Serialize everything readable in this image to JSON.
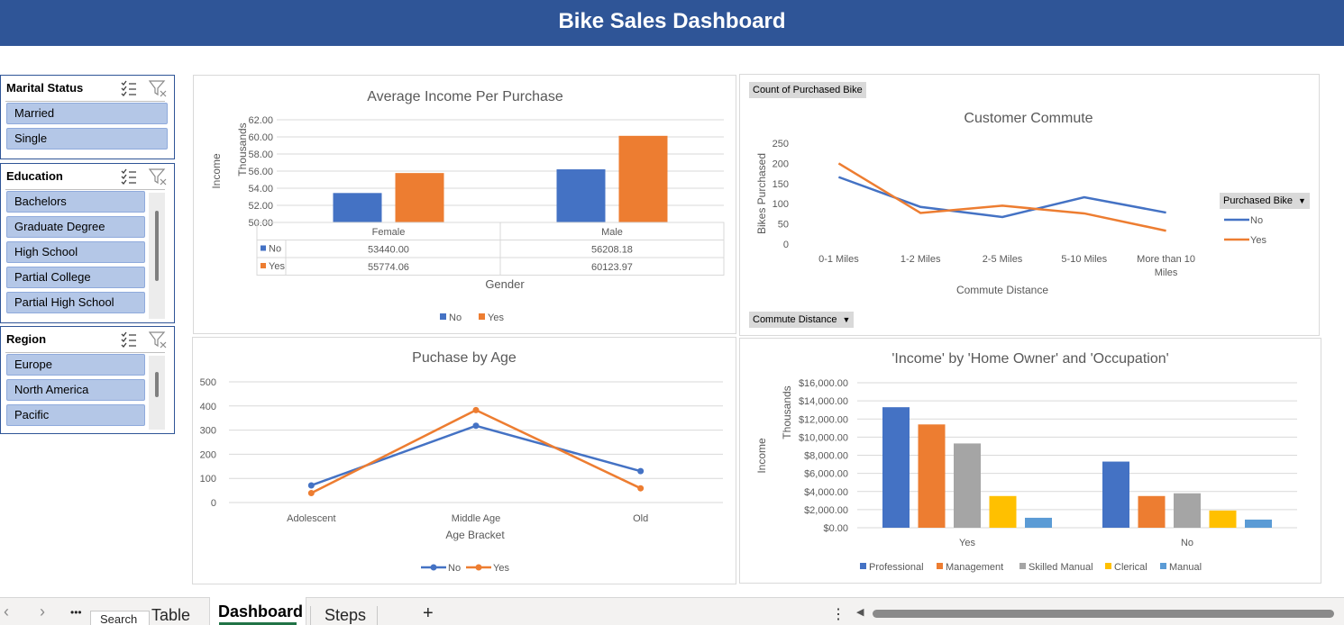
{
  "banner": {
    "title": "Bike Sales Dashboard",
    "bg": "#2f5597"
  },
  "colors": {
    "no": "#4472c4",
    "yes": "#ed7d31",
    "skilled": "#a5a5a5",
    "clerical": "#ffc000",
    "manual": "#5b9bd5"
  },
  "slicers": [
    {
      "title": "Marital Status",
      "items": [
        "Married",
        "Single"
      ],
      "scroll": false
    },
    {
      "title": "Education",
      "items": [
        "Bachelors",
        "Graduate Degree",
        "High School",
        "Partial College",
        "Partial High School"
      ],
      "scroll": true
    },
    {
      "title": "Region",
      "items": [
        "Europe",
        "North America",
        "Pacific"
      ],
      "scroll": true
    }
  ],
  "chart_data": [
    {
      "type": "bar",
      "title": "Average Income Per Purchase",
      "xlabel": "Gender",
      "ylabel": "Income",
      "yunit": "Thousands",
      "categories": [
        "Female",
        "Male"
      ],
      "series": [
        {
          "name": "No",
          "values": [
            53440.0,
            56208.18
          ],
          "labels": [
            "53440.00",
            "56208.18"
          ]
        },
        {
          "name": "Yes",
          "values": [
            55774.06,
            60123.97
          ],
          "labels": [
            "55774.06",
            "60123.97"
          ]
        }
      ],
      "yticks": [
        "62.00",
        "60.00",
        "58.00",
        "56.00",
        "54.00",
        "52.00",
        "50.00"
      ],
      "ylim": [
        50,
        62
      ],
      "legend": [
        "No",
        "Yes"
      ],
      "legend_position": "bottom",
      "data_table": true,
      "grid": true
    },
    {
      "type": "line",
      "title": "Customer Commute",
      "xlabel": "Commute Distance",
      "ylabel": "Bikes Purchased",
      "categories": [
        "0-1 Miles",
        "1-2 Miles",
        "2-5 Miles",
        "5-10 Miles",
        "More than 10 Miles"
      ],
      "series": [
        {
          "name": "No",
          "values": [
            166,
            92,
            67,
            116,
            78
          ]
        },
        {
          "name": "Yes",
          "values": [
            200,
            77,
            95,
            76,
            33
          ]
        }
      ],
      "yticks": [
        "250",
        "200",
        "150",
        "100",
        "50",
        "0"
      ],
      "ylim": [
        0,
        250
      ],
      "pivot_value_button": "Count of Purchased Bike",
      "pivot_axis_button": "Commute Distance",
      "legend_title": "Purchased Bike",
      "legend": [
        "No",
        "Yes"
      ],
      "legend_position": "right",
      "grid": false
    },
    {
      "type": "line",
      "title": "Puchase by Age",
      "xlabel": "Age Bracket",
      "categories": [
        "Adolescent",
        "Middle Age",
        "Old"
      ],
      "series": [
        {
          "name": "No",
          "values": [
            71,
            318,
            130
          ]
        },
        {
          "name": "Yes",
          "values": [
            39,
            383,
            59
          ]
        }
      ],
      "yticks": [
        "500",
        "400",
        "300",
        "200",
        "100",
        "0"
      ],
      "ylim": [
        0,
        500
      ],
      "legend": [
        "No",
        "Yes"
      ],
      "legend_position": "bottom",
      "markers": true,
      "grid": true
    },
    {
      "type": "bar",
      "title": "'Income' by 'Home Owner' and 'Occupation'",
      "ylabel": "Income",
      "yunit": "Thousands",
      "categories": [
        "Yes",
        "No"
      ],
      "series": [
        {
          "name": "Professional",
          "values": [
            13300,
            7300
          ]
        },
        {
          "name": "Management",
          "values": [
            11400,
            3500
          ]
        },
        {
          "name": "Skilled Manual",
          "values": [
            9300,
            3800
          ]
        },
        {
          "name": "Clerical",
          "values": [
            3500,
            1900
          ]
        },
        {
          "name": "Manual",
          "values": [
            1100,
            900
          ]
        }
      ],
      "yticks": [
        "$16,000.00",
        "$14,000.00",
        "$12,000.00",
        "$10,000.00",
        "$8,000.00",
        "$6,000.00",
        "$4,000.00",
        "$2,000.00",
        "$0.00"
      ],
      "ylim": [
        0,
        16000
      ],
      "legend": [
        "Professional",
        "Management",
        "Skilled Manual",
        "Clerical",
        "Manual"
      ],
      "legend_position": "bottom",
      "grid": true
    }
  ],
  "tabbar": {
    "tabs": [
      "Table",
      "Dashboard",
      "Steps"
    ],
    "active": "Dashboard",
    "search_tip": "Search",
    "prev_icon": "‹",
    "next_icon": "›",
    "more_icon": "•••",
    "add_icon": "+",
    "options_icon": "⋮",
    "scroll_left_icon": "◀"
  }
}
